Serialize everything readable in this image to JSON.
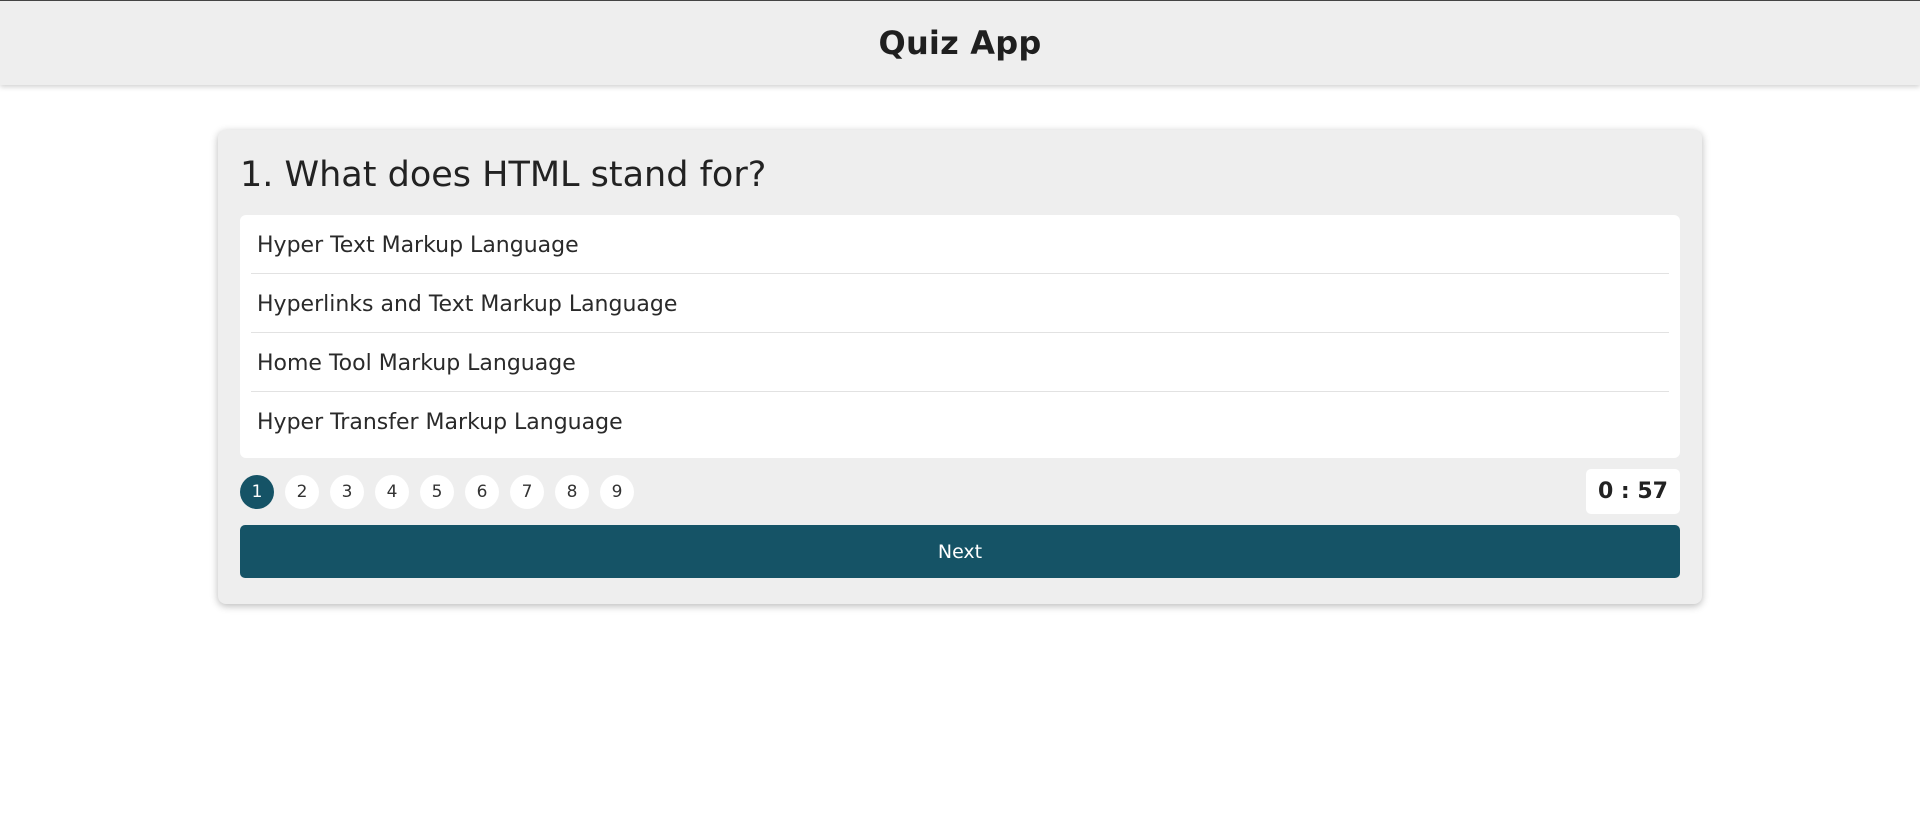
{
  "app": {
    "title": "Quiz App"
  },
  "quiz": {
    "question": "1. What does HTML stand for?",
    "answers": [
      "Hyper Text Markup Language",
      "Hyperlinks and Text Markup Language",
      "Home Tool Markup Language",
      "Hyper Transfer Markup Language"
    ],
    "pages": [
      "1",
      "2",
      "3",
      "4",
      "5",
      "6",
      "7",
      "8",
      "9"
    ],
    "current_page": "1",
    "timer": "0 : 57",
    "next_label": "Next"
  },
  "colors": {
    "accent": "#155366",
    "header_bg": "#eeeeee",
    "card_bg": "#eeeeee"
  }
}
